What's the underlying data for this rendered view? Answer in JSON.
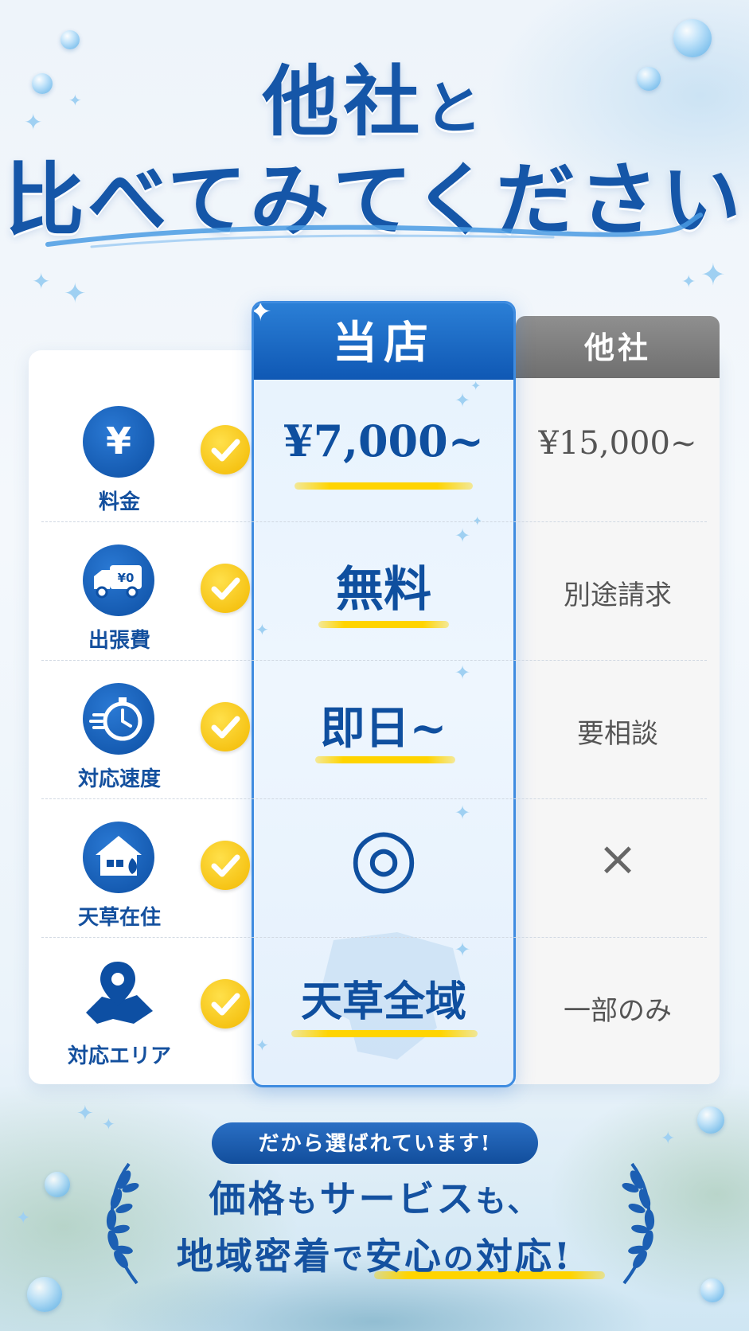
{
  "title": {
    "line1_main": "他社",
    "line1_small": "と",
    "line2": "比べてみてください"
  },
  "columns": {
    "ours": "当店",
    "other": "他社"
  },
  "rows": [
    {
      "label": "料金",
      "icon": "yen-icon",
      "ours": "¥7,000~",
      "other": "¥15,000~"
    },
    {
      "label": "出張費",
      "icon": "truck-icon",
      "icon_text": "¥0",
      "ours": "無料",
      "other": "別途請求"
    },
    {
      "label": "対応速度",
      "icon": "stopwatch-icon",
      "ours": "即日~",
      "other": "要相談"
    },
    {
      "label": "天草在住",
      "icon": "house-icon",
      "ours": "◎",
      "other": "×"
    },
    {
      "label": "対応エリア",
      "icon": "map-pin-icon",
      "ours": "天草全域",
      "other": "一部のみ"
    }
  ],
  "footer": {
    "pill": "だから選ばれています!",
    "line1_a": "価格",
    "line1_b": "も",
    "line1_c": "サービス",
    "line1_d": "も、",
    "line2_a": "地域密着",
    "line2_b": "で",
    "line2_c": "安心",
    "line2_d": "の",
    "line2_e": "対応!"
  },
  "colors": {
    "brand_blue": "#1556a8",
    "accent_yellow": "#ffd400",
    "other_gray": "#7a7a7a"
  }
}
